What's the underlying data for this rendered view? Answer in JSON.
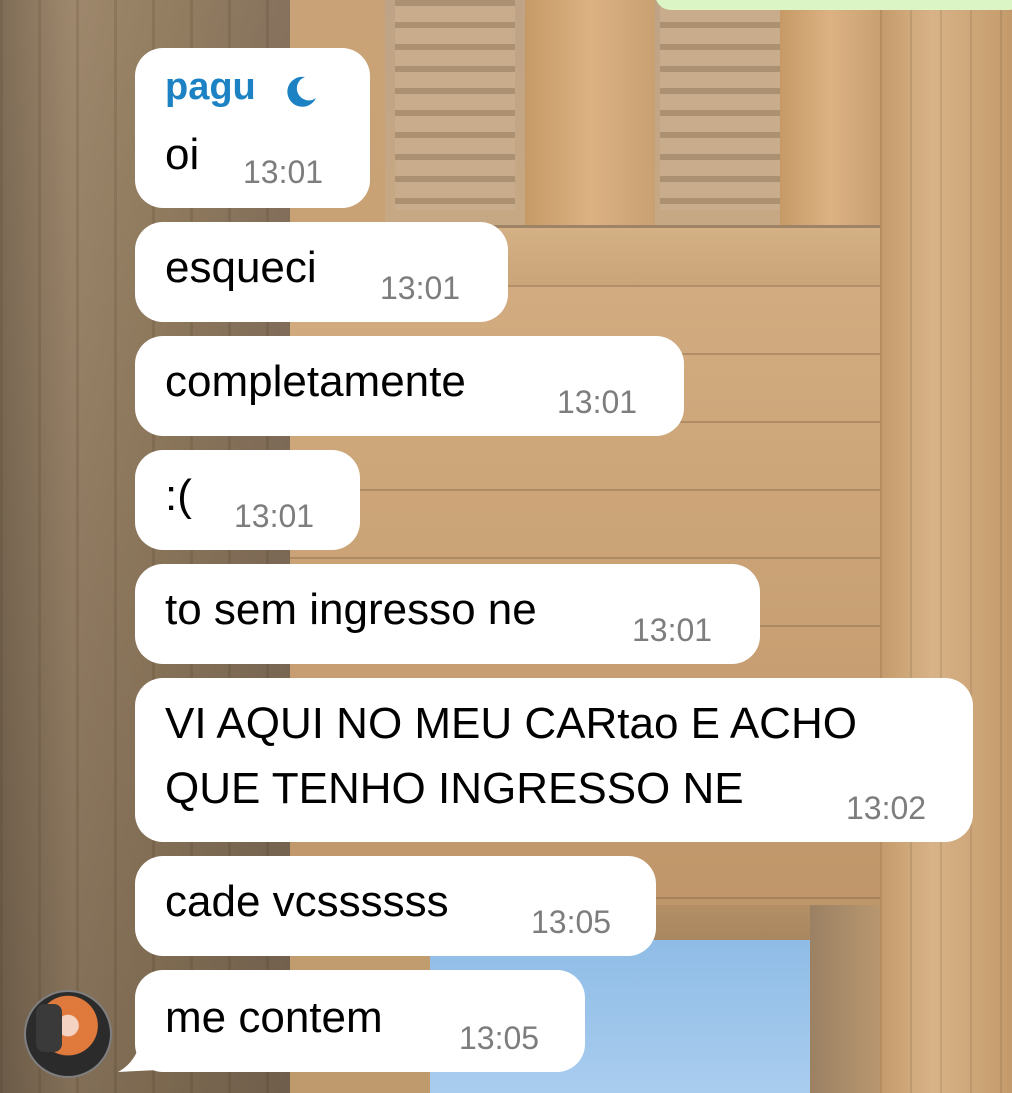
{
  "chat": {
    "sender_name": "pagu",
    "sender_badge_icon": "crescent-moon-icon",
    "messages": [
      {
        "text": "oi",
        "time": "13:01"
      },
      {
        "text": "esqueci",
        "time": "13:01"
      },
      {
        "text": "completamente",
        "time": "13:01"
      },
      {
        "text": ":(",
        "time": "13:01"
      },
      {
        "text": "to sem ingresso ne",
        "time": "13:01"
      },
      {
        "text_line1": "VI AQUI NO MEU CARtao E ACHO",
        "text_line2": "QUE TENHO INGRESSO NE",
        "time": "13:02"
      },
      {
        "text": "cade vcssssss",
        "time": "13:05"
      },
      {
        "text": "me contem",
        "time": "13:05"
      }
    ]
  },
  "colors": {
    "bubble": "#ffffff",
    "sender_name": "#1d82c4",
    "timestamp": "#7d7d7d",
    "outgoing_bubble": "#dcf5c4"
  }
}
